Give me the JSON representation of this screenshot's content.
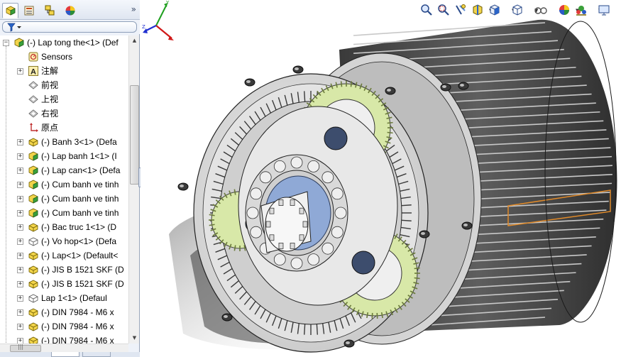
{
  "left_panel": {
    "tabs": [
      {
        "name": "feature-manager",
        "icon": "feature-tree-icon",
        "active": true
      },
      {
        "name": "property-manager",
        "icon": "property-manager-icon",
        "active": false
      },
      {
        "name": "configuration-manager",
        "icon": "configuration-manager-icon",
        "active": false
      },
      {
        "name": "display-manager",
        "icon": "appearance-icon",
        "active": false
      }
    ],
    "expand_glyph": "»",
    "filter_icon": "filter-icon",
    "tree": [
      {
        "label": "(-) Lap tong the<1> (Def",
        "icon": "assembly-icon",
        "level": 0,
        "expander": "−"
      },
      {
        "label": "Sensors",
        "icon": "sensor-icon",
        "level": 1,
        "expander": ""
      },
      {
        "label": "注解",
        "icon": "annotation-icon",
        "level": 1,
        "expander": "+"
      },
      {
        "label": "前视",
        "icon": "plane-icon",
        "level": 1,
        "expander": ""
      },
      {
        "label": "上视",
        "icon": "plane-icon",
        "level": 1,
        "expander": ""
      },
      {
        "label": "右视",
        "icon": "plane-icon",
        "level": 1,
        "expander": ""
      },
      {
        "label": "原点",
        "icon": "origin-icon",
        "level": 1,
        "expander": ""
      },
      {
        "label": "(-) Banh 3<1> (Defa",
        "icon": "part-icon",
        "level": 1,
        "expander": "+"
      },
      {
        "label": "(-) Lap banh 1<1> (I",
        "icon": "subassembly-icon",
        "level": 1,
        "expander": "+"
      },
      {
        "label": "(-) Lap can<1> (Defa",
        "icon": "subassembly-icon",
        "level": 1,
        "expander": "+"
      },
      {
        "label": "(-) Cum banh ve tinh",
        "icon": "subassembly-icon",
        "level": 1,
        "expander": "+"
      },
      {
        "label": "(-) Cum banh ve tinh",
        "icon": "subassembly-icon",
        "level": 1,
        "expander": "+"
      },
      {
        "label": "(-) Cum banh ve tinh",
        "icon": "subassembly-icon",
        "level": 1,
        "expander": "+"
      },
      {
        "label": "(-) Bac truc 1<1> (D",
        "icon": "part-icon",
        "level": 1,
        "expander": "+"
      },
      {
        "label": "(-) Vo hop<1> (Defa",
        "icon": "hidden-part-icon",
        "level": 1,
        "expander": "+"
      },
      {
        "label": "(-) Lap<1> (Default<",
        "icon": "part-icon",
        "level": 1,
        "expander": "+"
      },
      {
        "label": "(-) JIS B 1521 SKF (D",
        "icon": "part-icon",
        "level": 1,
        "expander": "+"
      },
      {
        "label": "(-) JIS B 1521 SKF (D",
        "icon": "part-icon",
        "level": 1,
        "expander": "+"
      },
      {
        "label": "Lap 1<1> (Defaul",
        "icon": "hidden-part-icon",
        "level": 1,
        "expander": "+"
      },
      {
        "label": "(-) DIN 7984 - M6 x",
        "icon": "part-icon",
        "level": 1,
        "expander": "+"
      },
      {
        "label": "(-) DIN 7984 - M6 x",
        "icon": "part-icon",
        "level": 1,
        "expander": "+"
      },
      {
        "label": "(-) DIN 7984 - M6 x",
        "icon": "part-icon",
        "level": 1,
        "expander": "+"
      }
    ],
    "hscroll_glyph": "|||"
  },
  "heads_up_toolbar": [
    {
      "name": "zoom-to-fit",
      "icon": "zoom-fit-icon"
    },
    {
      "name": "zoom-to-area",
      "icon": "zoom-area-icon"
    },
    {
      "name": "previous-view",
      "icon": "previous-view-icon"
    },
    {
      "name": "section-view",
      "icon": "section-view-icon"
    },
    {
      "name": "view-orientation",
      "icon": "view-orientation-icon",
      "dropdown": true
    },
    {
      "name": "display-style",
      "icon": "display-style-icon",
      "dropdown": true
    },
    {
      "name": "hide-show-items",
      "icon": "hide-show-icon",
      "dropdown": true
    },
    {
      "name": "edit-appearance",
      "icon": "appearance-ball-icon"
    },
    {
      "name": "apply-scene",
      "icon": "scene-icon",
      "dropdown": true
    },
    {
      "name": "view-settings",
      "icon": "monitor-icon",
      "dropdown": true
    }
  ],
  "colors": {
    "gear_green": "#d8e8a8",
    "housing_gray": "#d9d9d9",
    "highlight_orange": "#e08a2a",
    "ring_blue": "#8fa9d6",
    "triad_x": "#d01818",
    "triad_y": "#20a020",
    "triad_z": "#2030d0"
  }
}
